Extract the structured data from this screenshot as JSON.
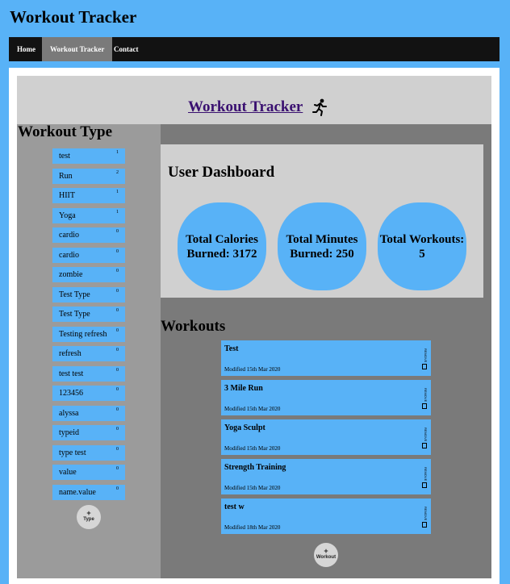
{
  "site": {
    "title": "Workout Tracker"
  },
  "nav": {
    "items": [
      "Home",
      "Workout Tracker",
      "Contact"
    ]
  },
  "page": {
    "title": "Workout Tracker"
  },
  "sidebar": {
    "title": "Workout Type",
    "types": [
      {
        "name": "test",
        "count": "1"
      },
      {
        "name": "Run",
        "count": "2"
      },
      {
        "name": "HIIT",
        "count": "1"
      },
      {
        "name": "Yoga",
        "count": "1"
      },
      {
        "name": "cardio",
        "count": "0"
      },
      {
        "name": "cardio",
        "count": "0"
      },
      {
        "name": "zombie",
        "count": "0"
      },
      {
        "name": "Test Type",
        "count": "0"
      },
      {
        "name": "Test Type",
        "count": "0"
      },
      {
        "name": "Testing refresh",
        "count": "0"
      },
      {
        "name": "refresh",
        "count": "0"
      },
      {
        "name": "test test",
        "count": "0"
      },
      {
        "name": "123456",
        "count": "0"
      },
      {
        "name": "alyssa",
        "count": "0"
      },
      {
        "name": "typeid",
        "count": "0"
      },
      {
        "name": "type test",
        "count": "0"
      },
      {
        "name": "value",
        "count": "0"
      },
      {
        "name": "name.value",
        "count": "0"
      }
    ],
    "add_label": "Type"
  },
  "dashboard": {
    "title": "User Dashboard",
    "stats": [
      {
        "label": "Total Calories Burned: 3172"
      },
      {
        "label": "Total Minutes Burned: 250"
      },
      {
        "label": "Total Workouts: 5"
      }
    ]
  },
  "workouts": {
    "title": "Workouts",
    "remove_label": "REMOVE",
    "items": [
      {
        "name": "Test",
        "modified": "Modified 15th Mar 2020"
      },
      {
        "name": "3 Mile Run",
        "modified": "Modified 15th Mar 2020"
      },
      {
        "name": "Yoga Sculpt",
        "modified": "Modified 15th Mar 2020"
      },
      {
        "name": "Strength Training",
        "modified": "Modified 15th Mar 2020"
      },
      {
        "name": "test w",
        "modified": "Modified 18th Mar 2020"
      }
    ],
    "add_label": "Workout"
  }
}
